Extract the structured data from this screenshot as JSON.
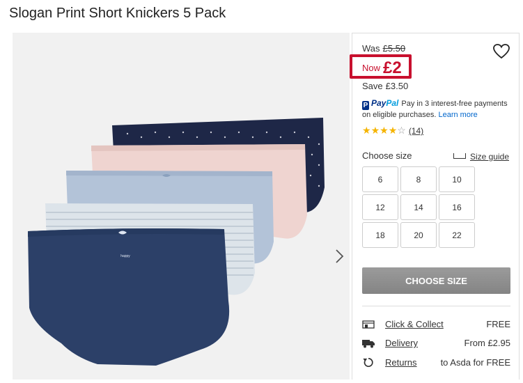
{
  "product": {
    "title": "Slogan Print Short Knickers 5 Pack"
  },
  "gallery": {
    "image_alt": "Five pairs of short knickers in navy, grey stripe, blue, pink and navy polka dot",
    "next_icon": "chevron-right-icon"
  },
  "pricing": {
    "was_label": "Was",
    "was_price": "£5.50",
    "now_label": "Now",
    "now_price": "£2",
    "save_label": "Save",
    "save_amount": "£3.50",
    "highlight_color": "#c8102e"
  },
  "paypal": {
    "logo_p": "P",
    "logo_text_pay": "Pay",
    "logo_text_pal": "Pal",
    "message": "Pay in 3 interest-free payments on eligible purchases.",
    "learn_more": "Learn more"
  },
  "rating": {
    "stars": 4,
    "max_stars": 5,
    "count": "(14)"
  },
  "size_selector": {
    "label": "Choose size",
    "guide_label": "Size guide",
    "options": [
      "6",
      "8",
      "10",
      "12",
      "14",
      "16",
      "18",
      "20",
      "22"
    ],
    "cta": "CHOOSE SIZE"
  },
  "delivery": [
    {
      "icon": "store-icon",
      "label": "Click & Collect",
      "value": "FREE"
    },
    {
      "icon": "truck-icon",
      "label": "Delivery",
      "value": "From £2.95"
    },
    {
      "icon": "return-icon",
      "label": "Returns",
      "value": "to Asda for FREE"
    }
  ]
}
